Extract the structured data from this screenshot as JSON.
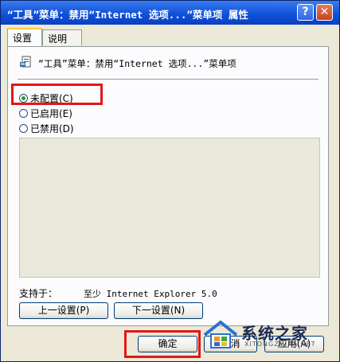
{
  "window": {
    "title": "“工具”菜单：禁用“Internet 选项...”菜单项 属性",
    "help_label": "?",
    "close_label": "✕"
  },
  "tabs": [
    {
      "label": "设置",
      "active": true
    },
    {
      "label": "说明",
      "active": false
    }
  ],
  "policy": {
    "icon": "policy-document-icon",
    "name": "“工具”菜单：禁用“Internet 选项...”菜单项"
  },
  "options": [
    {
      "label": "未配置(C)",
      "selected": true
    },
    {
      "label": "已启用(E)",
      "selected": false
    },
    {
      "label": "已禁用(D)",
      "selected": false
    }
  ],
  "supported": {
    "label": "支持于：",
    "value": "至少 Internet Explorer 5.0"
  },
  "buttons": {
    "prev": "上一设置(P)",
    "next": "下一设置(N)",
    "ok": "确定",
    "cancel": "取消",
    "apply": "应用(A)"
  },
  "watermark": {
    "text": "系统之家",
    "url": "XITONGZHIJIA.NET"
  },
  "colors": {
    "titlebar": "#0f52d8",
    "highlight": "#e01818",
    "face": "#ece9d8"
  }
}
